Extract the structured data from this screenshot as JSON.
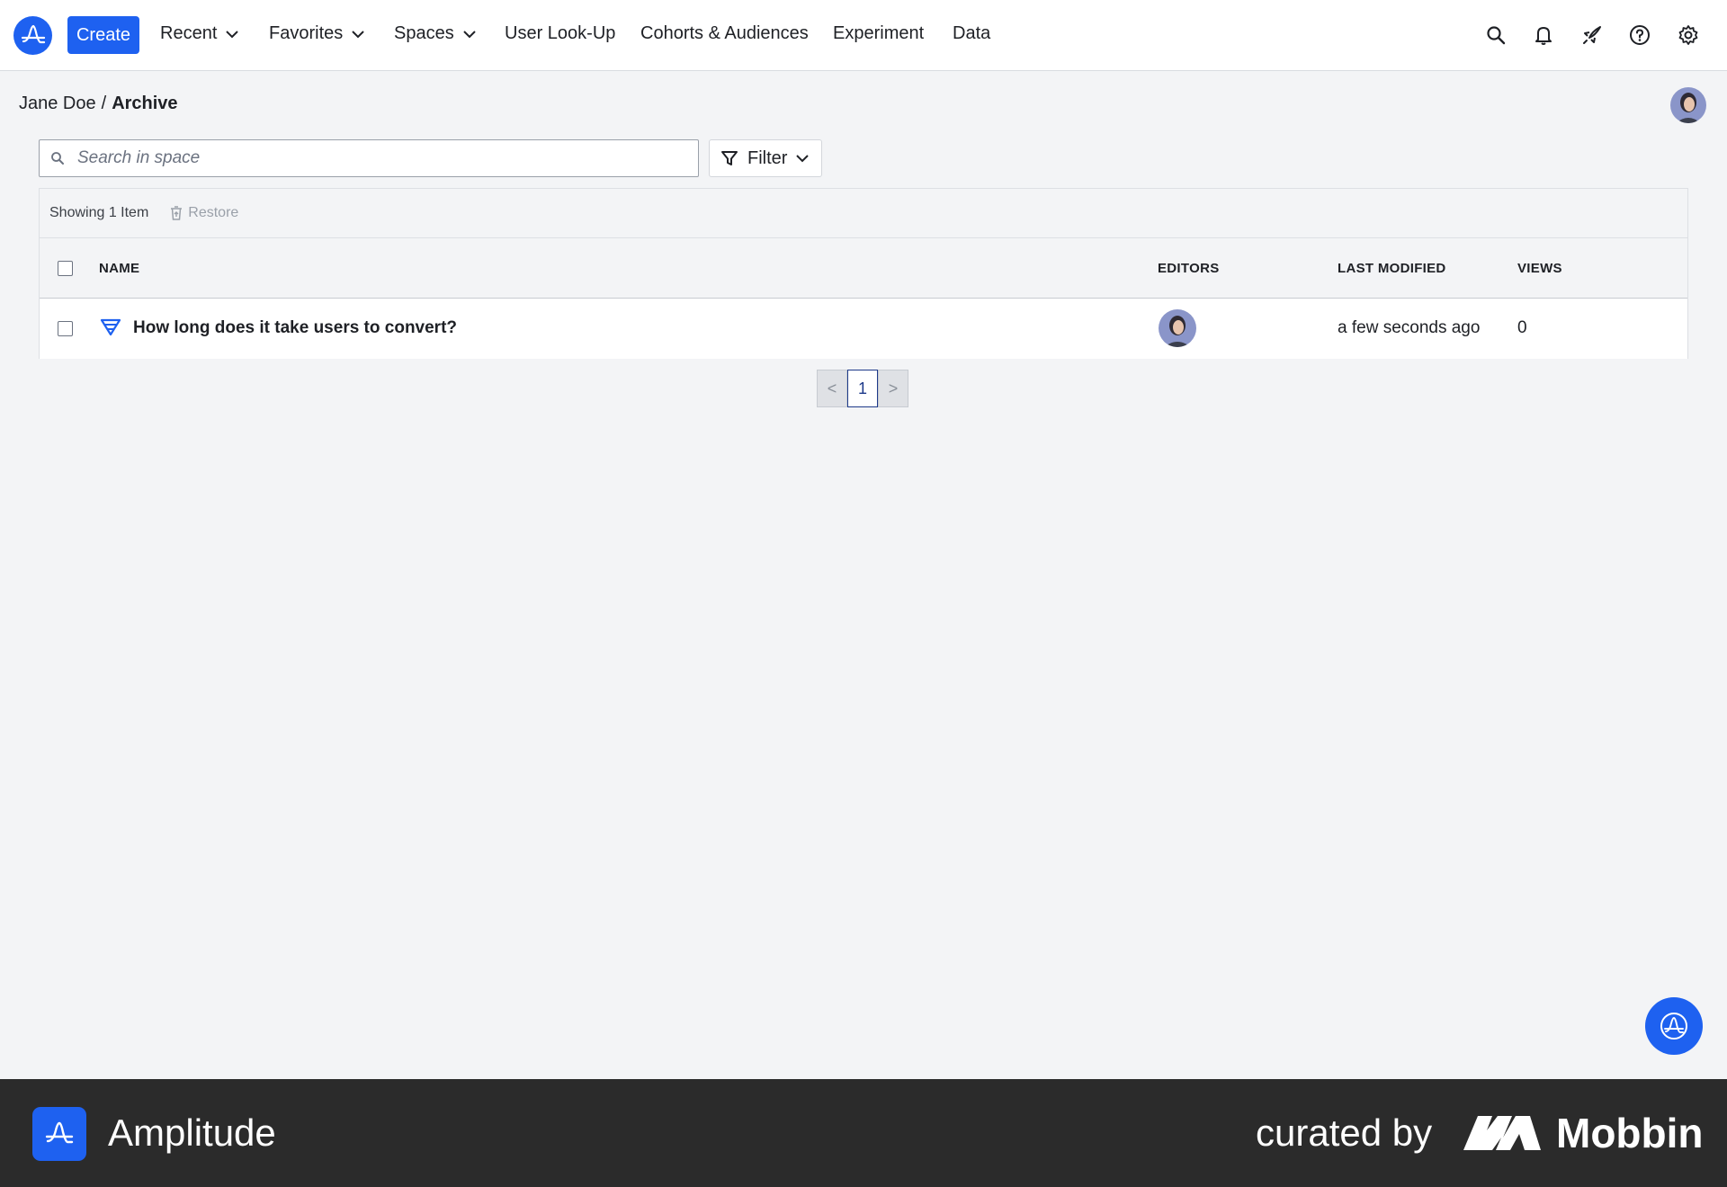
{
  "nav": {
    "create_label": "Create",
    "recent_label": "Recent",
    "favorites_label": "Favorites",
    "spaces_label": "Spaces",
    "user_lookup_label": "User Look-Up",
    "cohorts_label": "Cohorts & Audiences",
    "experiment_label": "Experiment",
    "data_label": "Data",
    "icons": [
      "search-icon",
      "bell-icon",
      "rocket-icon",
      "help-icon",
      "gear-icon"
    ]
  },
  "breadcrumb": {
    "owner": "Jane Doe",
    "separator": "/",
    "current": "Archive"
  },
  "search": {
    "placeholder": "Search in space",
    "value": ""
  },
  "filter": {
    "label": "Filter"
  },
  "toolbar": {
    "showing": "Showing 1 Item",
    "restore_label": "Restore"
  },
  "table": {
    "columns": {
      "name": "NAME",
      "editors": "EDITORS",
      "last_modified": "LAST MODIFIED",
      "views": "VIEWS"
    },
    "rows": [
      {
        "name": "How long does it take users to convert?",
        "icon": "funnel-chart-icon",
        "last_modified": "a few seconds ago",
        "views": "0"
      }
    ]
  },
  "pagination": {
    "prev": "<",
    "current": "1",
    "next": ">"
  },
  "footer": {
    "brand": "Amplitude",
    "curated_by": "curated by",
    "mobbin": "Mobbin"
  },
  "colors": {
    "accent": "#1e61f0",
    "background": "#f3f4f6",
    "footer": "#2b2b2b"
  }
}
